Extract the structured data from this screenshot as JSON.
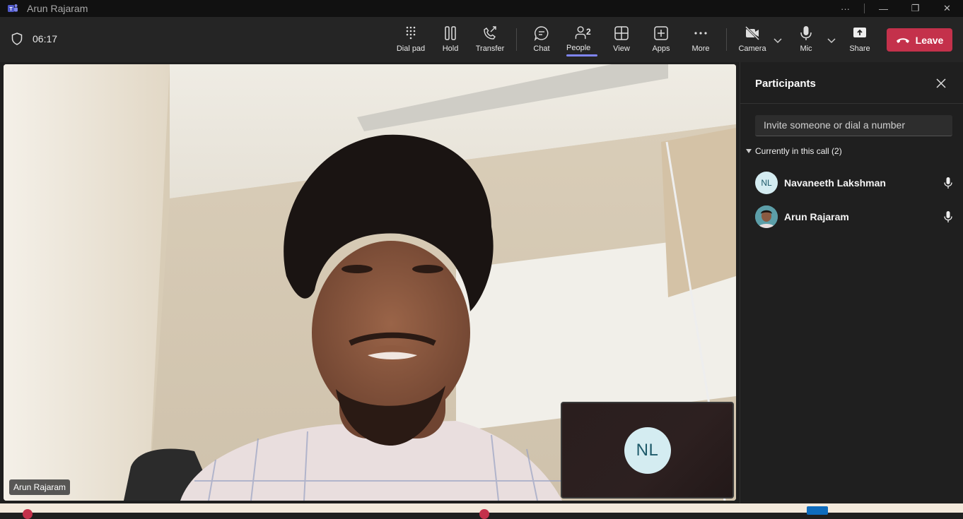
{
  "window": {
    "title": "Arun Rajaram",
    "more": "···",
    "minimize": "—",
    "restore": "❐",
    "close": "✕"
  },
  "toolbar": {
    "timer": "06:17",
    "buttons": {
      "dialpad": "Dial pad",
      "hold": "Hold",
      "transfer": "Transfer",
      "chat": "Chat",
      "people": "People",
      "people_count": "2",
      "view": "View",
      "apps": "Apps",
      "more": "More",
      "camera": "Camera",
      "mic": "Mic",
      "share": "Share"
    },
    "leave": "Leave",
    "colors": {
      "leave": "#c4314b",
      "active_underline": "#7f85f5"
    }
  },
  "stage": {
    "speaker_name": "Arun Rajaram",
    "pip_initials": "NL"
  },
  "participants_panel": {
    "title": "Participants",
    "invite_placeholder": "Invite someone or dial a number",
    "section_label": "Currently in this call (2)",
    "people": [
      {
        "name": "Navaneeth Lakshman",
        "initials": "NL",
        "avatar": "initials",
        "mic_icon": "mic-icon"
      },
      {
        "name": "Arun Rajaram",
        "initials": "",
        "avatar": "photo",
        "mic_icon": "mic-icon"
      }
    ]
  }
}
